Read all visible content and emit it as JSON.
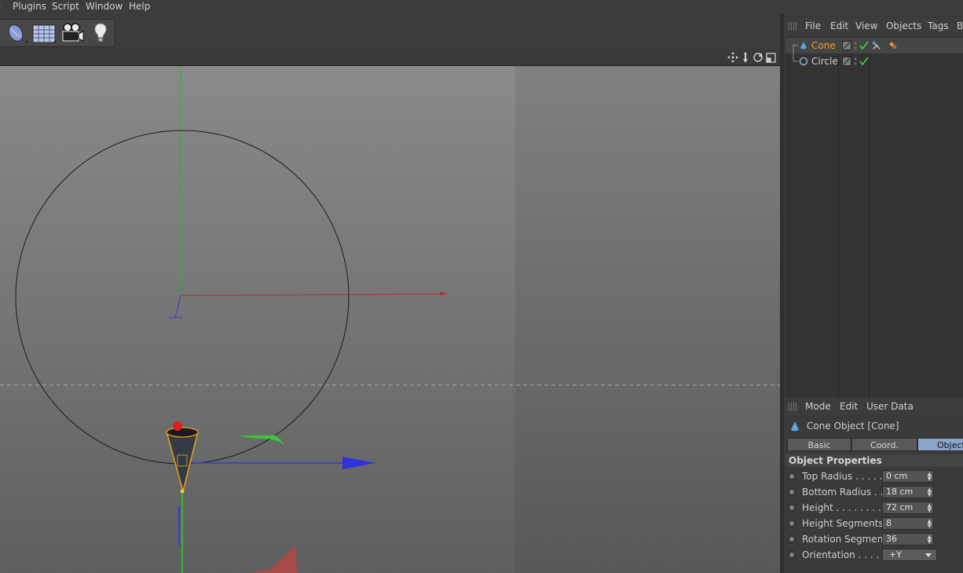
{
  "menubar": {
    "items": [
      "Plugins",
      "Script",
      "Window",
      "Help"
    ]
  },
  "toolbar": {
    "tools": [
      "deformer-icon",
      "floor-grid-icon",
      "camera-icon",
      "light-icon"
    ]
  },
  "object_manager": {
    "menu": [
      "File",
      "Edit",
      "View",
      "Objects",
      "Tags",
      "B"
    ],
    "objects": [
      {
        "name": "Cone",
        "icon": "cone-icon",
        "selected": true
      },
      {
        "name": "Circle",
        "icon": "circle-spline-icon",
        "selected": false
      }
    ],
    "colors": {
      "selected": "#f0a030"
    }
  },
  "attribute_manager": {
    "menu": [
      "Mode",
      "Edit",
      "User Data"
    ],
    "title": "Cone Object [Cone]",
    "tabs": [
      {
        "label": "Basic",
        "active": false
      },
      {
        "label": "Coord.",
        "active": false
      },
      {
        "label": "Object",
        "active": true
      }
    ],
    "group_title": "Object Properties",
    "properties": [
      {
        "label": "Top Radius . . . . . .",
        "value": "0 cm",
        "type": "number"
      },
      {
        "label": "Bottom Radius . . .",
        "value": "18 cm",
        "type": "number"
      },
      {
        "label": "Height . . . . . . . . . .",
        "value": "72 cm",
        "type": "number"
      },
      {
        "label": "Height Segments",
        "value": "8",
        "type": "number"
      },
      {
        "label": "Rotation Segments",
        "value": "36",
        "type": "number"
      },
      {
        "label": "Orientation . . . . . .",
        "value": "+Y",
        "type": "select"
      }
    ]
  }
}
